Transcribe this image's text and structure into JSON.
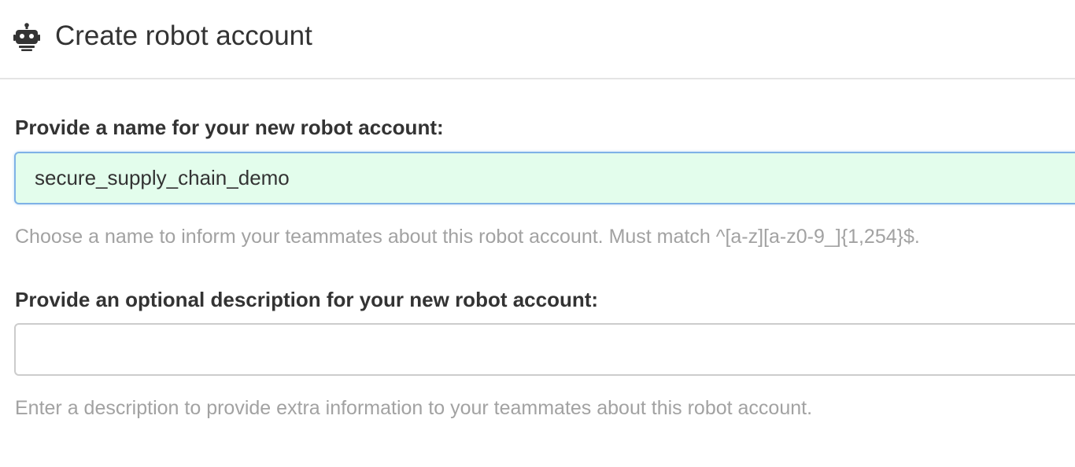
{
  "header": {
    "icon": "robot-icon",
    "title": "Create robot account"
  },
  "name_field": {
    "label": "Provide a name for your new robot account:",
    "value": "secure_supply_chain_demo",
    "help": "Choose a name to inform your teammates about this robot account. Must match ^[a-z][a-z0-9_]{1,254}$."
  },
  "description_field": {
    "label": "Provide an optional description for your new robot account:",
    "value": "",
    "help": "Enter a description to provide extra information to your teammates about this robot account."
  },
  "colors": {
    "valid_input_background": "#e3fdec",
    "focus_border": "#7fb2e6",
    "help_text": "#a2a2a2"
  }
}
